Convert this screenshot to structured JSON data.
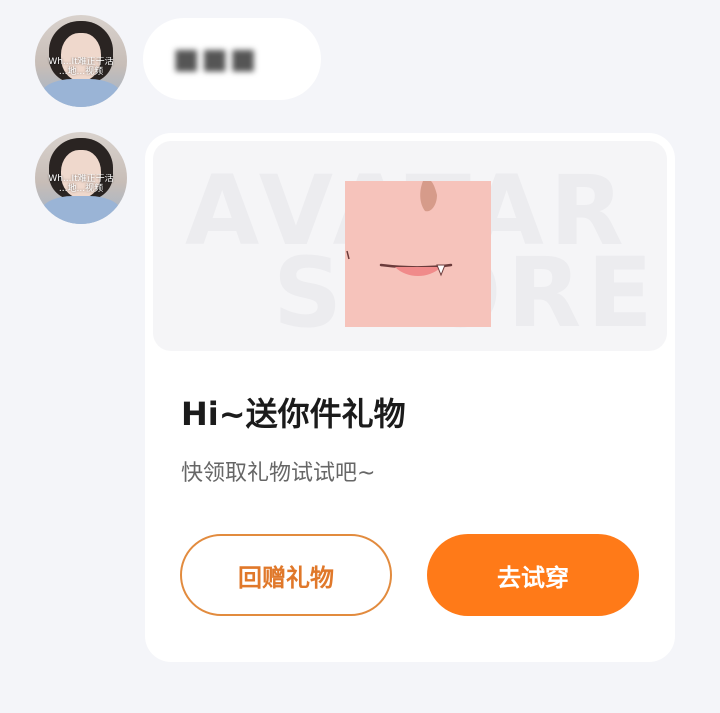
{
  "messages": [
    {
      "sender": "other",
      "avatar_overlay": [
        "Wh...It难正干活",
        "...地...视频"
      ],
      "text": "■■■"
    },
    {
      "sender": "other",
      "avatar_overlay": [
        "Wh...It难正干活",
        "...地...视频"
      ],
      "card": {
        "banner_watermark_top": "AVATAR",
        "banner_watermark_bottom": "STORE",
        "title": "Hi~送你件礼物",
        "subtitle": "快领取礼物试试吧~",
        "secondary_button": "回赠礼物",
        "primary_button": "去试穿"
      }
    }
  ],
  "colors": {
    "background": "#f4f5f9",
    "accent": "#ff7a18",
    "accent_outline": "#e28b3e"
  }
}
